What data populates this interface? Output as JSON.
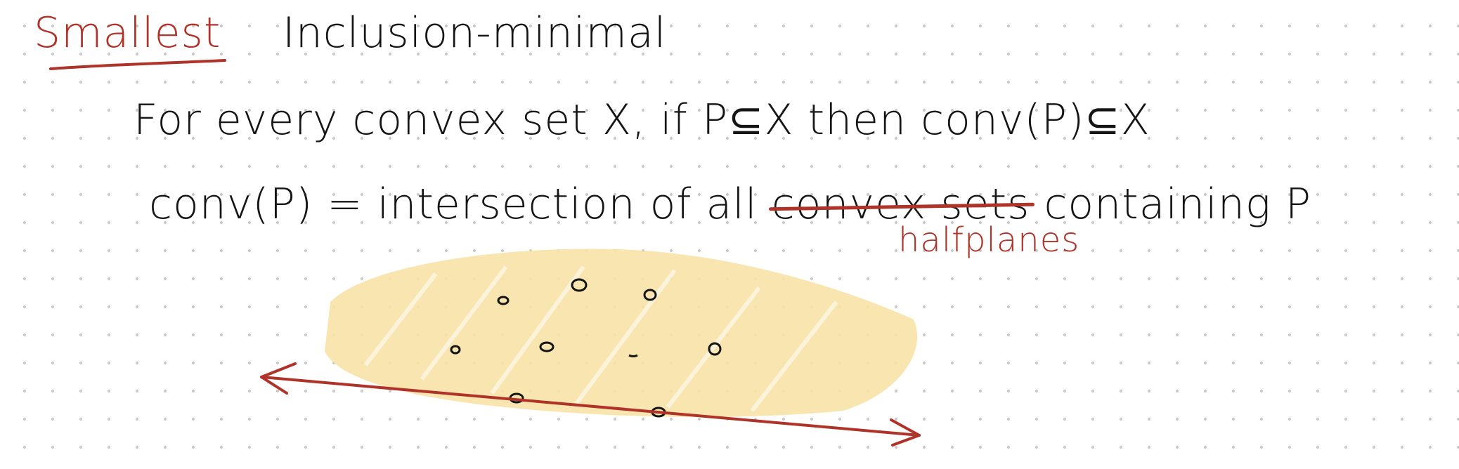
{
  "notes": {
    "label_smallest": "Smallest",
    "label_inclusion": "Inclusion-minimal",
    "line_definition": "For every convex set X, if P⊆X then conv(P)⊆X",
    "line_equation_prefix": "conv(P) = intersection of all",
    "struck_text": "convex sets",
    "line_equation_suffix": "containing P",
    "correction": "halfplanes"
  },
  "colors": {
    "ink": "#151515",
    "correction_ink": "#b0332a",
    "highlight": "#f8e2a6",
    "dot_grid": "#c9c9c9"
  }
}
